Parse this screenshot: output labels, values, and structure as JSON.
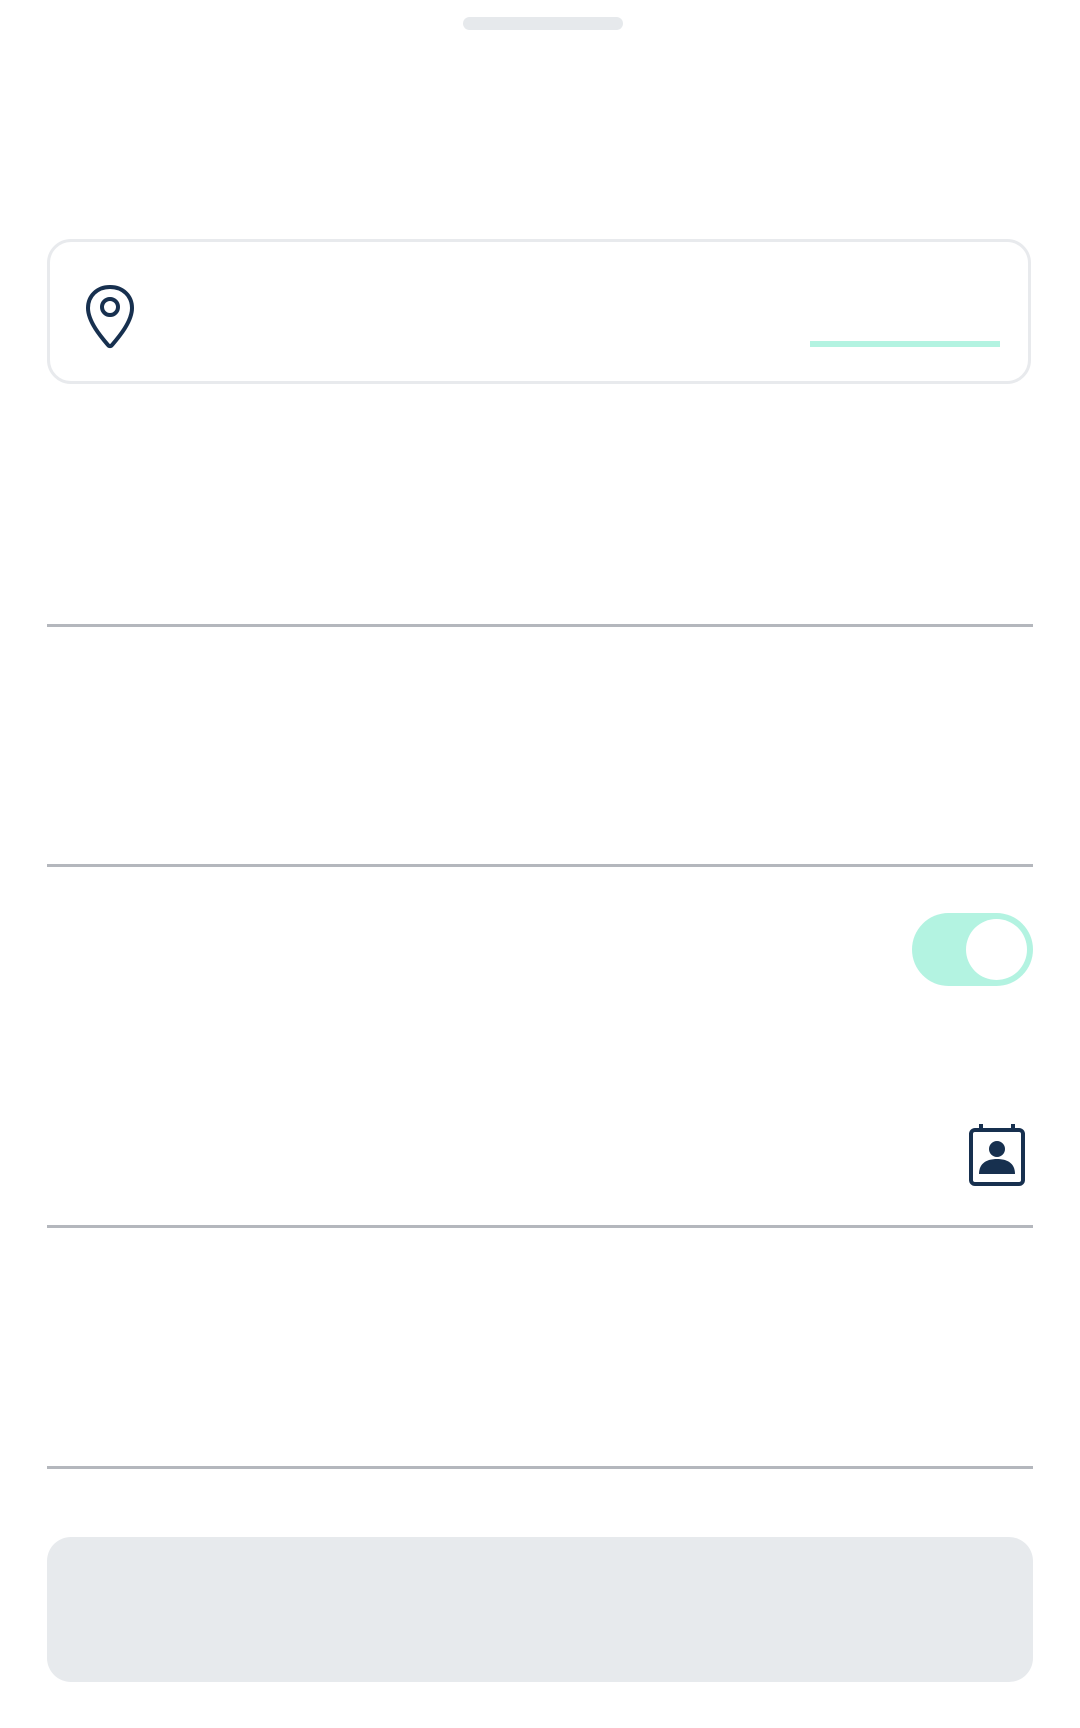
{
  "sheet": {
    "handle": "drag-handle"
  },
  "location": {
    "icon": "map-pin-icon",
    "address": "",
    "loading_color": "#b3f3e1"
  },
  "fields": {
    "field1_value": "",
    "field2_value": "",
    "field3_value": "",
    "field4_value": ""
  },
  "toggle": {
    "label": "",
    "on": true,
    "color": "#b3f3e1"
  },
  "contact": {
    "icon": "contact-book-icon"
  },
  "submit": {
    "label": "",
    "disabled": true,
    "color": "#e7eaed"
  },
  "colors": {
    "primary": "#17304f",
    "divider": "#b4b7bd",
    "accent": "#b3f3e1"
  }
}
